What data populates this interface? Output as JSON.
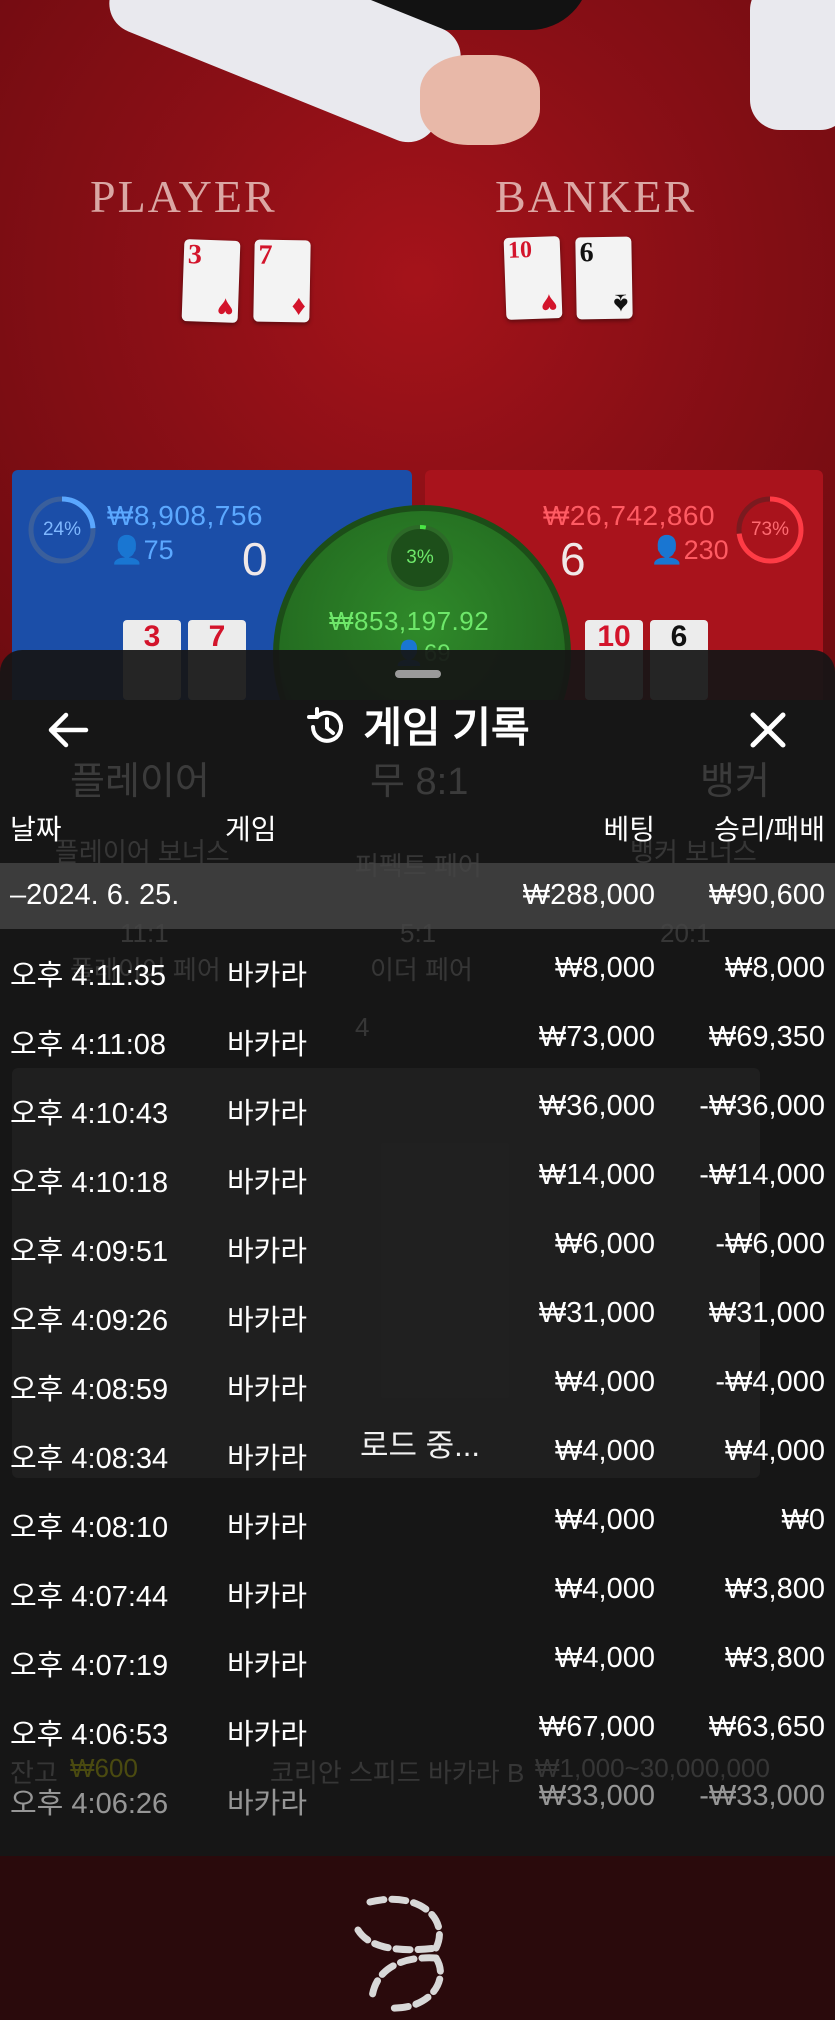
{
  "table": {
    "player_label": "PLAYER",
    "banker_label": "BANKER",
    "player_cards": [
      {
        "rank": "3",
        "suit": "♥"
      },
      {
        "rank": "7",
        "suit": "♦"
      }
    ],
    "banker_cards": [
      {
        "rank": "10",
        "suit": "♥"
      },
      {
        "rank": "6",
        "suit": "♠"
      }
    ]
  },
  "bets": {
    "player": {
      "percent": "24%",
      "amount": "₩8,908,756",
      "players": "75",
      "score": "0"
    },
    "tie": {
      "percent": "3%",
      "amount": "₩853,197.92",
      "players": "69"
    },
    "banker": {
      "percent": "73%",
      "amount": "₩26,742,860",
      "players": "230",
      "score": "6"
    },
    "player_ratio": 0.24,
    "tie_ratio": 0.03,
    "banker_ratio": 0.73,
    "mini_player_cards": [
      "3",
      "7"
    ],
    "mini_banker_cards": [
      "10",
      "6"
    ]
  },
  "background_ghost": {
    "player_bet": "플레이어",
    "tie_bet": "무 8:1",
    "banker_bet": "뱅커",
    "player_bonus": "플레이어 보너스",
    "perfect_pair": "퍼펙트 페어",
    "banker_bonus": "뱅커 보너스",
    "odds_11": "11:1",
    "odds_5": "5:1",
    "odds_20": "20:1",
    "player_pair": "플레이어 페어",
    "either_pair": "이더 페어",
    "count": "4",
    "balance_label": "잔고",
    "balance_value": "₩600",
    "table_name": "코리안 스피드 바카라 B",
    "limits": "₩1,000~30,000,000"
  },
  "modal": {
    "title": "게임 기록",
    "icon": "history-icon",
    "columns": {
      "date": "날짜",
      "game": "게임",
      "bet": "베팅",
      "result": "승리/패배"
    },
    "date_group": {
      "date": "–2024. 6. 25.",
      "bet": "₩288,000",
      "result": "₩90,600"
    },
    "rows": [
      {
        "time": "오후 4:11:35",
        "game": "바카라",
        "bet": "₩8,000",
        "result": "₩8,000"
      },
      {
        "time": "오후 4:11:08",
        "game": "바카라",
        "bet": "₩73,000",
        "result": "₩69,350"
      },
      {
        "time": "오후 4:10:43",
        "game": "바카라",
        "bet": "₩36,000",
        "result": "-₩36,000"
      },
      {
        "time": "오후 4:10:18",
        "game": "바카라",
        "bet": "₩14,000",
        "result": "-₩14,000"
      },
      {
        "time": "오후 4:09:51",
        "game": "바카라",
        "bet": "₩6,000",
        "result": "-₩6,000"
      },
      {
        "time": "오후 4:09:26",
        "game": "바카라",
        "bet": "₩31,000",
        "result": "₩31,000"
      },
      {
        "time": "오후 4:08:59",
        "game": "바카라",
        "bet": "₩4,000",
        "result": "-₩4,000"
      },
      {
        "time": "오후 4:08:34",
        "game": "바카라",
        "bet": "₩4,000",
        "result": "₩4,000"
      },
      {
        "time": "오후 4:08:10",
        "game": "바카라",
        "bet": "₩4,000",
        "result": "₩0"
      },
      {
        "time": "오후 4:07:44",
        "game": "바카라",
        "bet": "₩4,000",
        "result": "₩3,800"
      },
      {
        "time": "오후 4:07:19",
        "game": "바카라",
        "bet": "₩4,000",
        "result": "₩3,800"
      },
      {
        "time": "오후 4:06:53",
        "game": "바카라",
        "bet": "₩67,000",
        "result": "₩63,650"
      },
      {
        "time": "오후 4:06:26",
        "game": "바카라",
        "bet": "₩33,000",
        "result": "-₩33,000"
      }
    ],
    "loading_text": "로드 중..."
  },
  "colors": {
    "player_blue": "#4a9bf0",
    "banker_red": "#e8484f",
    "tie_green": "#3fd13a",
    "modal_bg": "#161616"
  }
}
